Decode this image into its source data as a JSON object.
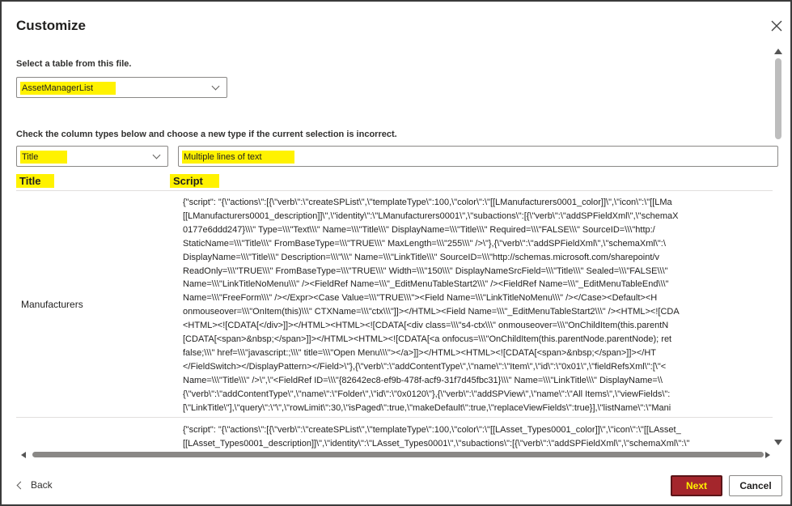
{
  "dialog": {
    "title": "Customize",
    "close_icon": "close-icon"
  },
  "table_section": {
    "label": "Select a table from this file.",
    "selected_table": "AssetManagerList"
  },
  "column_section": {
    "label": "Check the column types below and choose a new type if the current selection is incorrect.",
    "title_column_type": "Title",
    "script_column_type": "Multiple lines of text"
  },
  "grid": {
    "headers": [
      "Title",
      "Script"
    ],
    "rows": [
      {
        "title": "Manufacturers",
        "script_lines": [
          "{\"script\": \"{\\\"actions\\\":[{\\\"verb\\\":\\\"createSPList\\\",\\\"templateType\\\":100,\\\"color\\\":\\\"[[LManufacturers0001_color]]\\\",\\\"icon\\\":\\\"[[LMa",
          "[[LManufacturers0001_description]]\\\",\\\"identity\\\":\\\"LManufacturers0001\\\",\\\"subactions\\\":[{\\\"verb\\\":\\\"addSPFieldXml\\\",\\\"schemaX",
          "0177e6ddd247}\\\\\\\" Type=\\\\\\\"Text\\\\\\\" Name=\\\\\\\"Title\\\\\\\" DisplayName=\\\\\\\"Title\\\\\\\" Required=\\\\\\\"FALSE\\\\\\\" SourceID=\\\\\\\"http:/",
          "StaticName=\\\\\\\"Title\\\\\\\" FromBaseType=\\\\\\\"TRUE\\\\\\\" MaxLength=\\\\\\\"255\\\\\\\" />\\\"},{\\\"verb\\\":\\\"addSPFieldXml\\\",\\\"schemaXml\\\":\\",
          "DisplayName=\\\\\\\"Title\\\\\\\" Description=\\\\\\\"\\\\\\\" Name=\\\\\\\"LinkTitle\\\\\\\" SourceID=\\\\\\\"http://schemas.microsoft.com/sharepoint/v",
          "ReadOnly=\\\\\\\"TRUE\\\\\\\" FromBaseType=\\\\\\\"TRUE\\\\\\\" Width=\\\\\\\"150\\\\\\\" DisplayNameSrcField=\\\\\\\"Title\\\\\\\" Sealed=\\\\\\\"FALSE\\\\\\\"",
          "Name=\\\\\\\"LinkTitleNoMenu\\\\\\\" /><FieldRef Name=\\\\\\\"_EditMenuTableStart2\\\\\\\" /><FieldRef Name=\\\\\\\"_EditMenuTableEnd\\\\\\\"",
          "Name=\\\\\\\"FreeForm\\\\\\\" /></Expr><Case Value=\\\\\\\"TRUE\\\\\\\"><Field Name=\\\\\\\"LinkTitleNoMenu\\\\\\\" /></Case><Default><H",
          "onmouseover=\\\\\\\"OnItem(this)\\\\\\\" CTXName=\\\\\\\"ctx\\\\\\\"]]></HTML><Field Name=\\\\\\\"_EditMenuTableStart2\\\\\\\" /><HTML><![CDA",
          "<HTML><![CDATA[</div>]]></HTML><HTML><![CDATA[<div class=\\\\\\\"s4-ctx\\\\\\\" onmouseover=\\\\\\\"OnChildItem(this.parentN",
          "[CDATA[<span>&nbsp;</span>]]></HTML><HTML><![CDATA[<a onfocus=\\\\\\\"OnChildItem(this.parentNode.parentNode); ret",
          "false;\\\\\\\" href=\\\\\\\"javascript:;\\\\\\\" title=\\\\\\\"Open Menu\\\\\\\"></a>]]></HTML><HTML><![CDATA[<span>&nbsp;</span>]]></HT",
          "</FieldSwitch></DisplayPattern></Field>\\\"},{\\\"verb\\\":\\\"addContentType\\\",\\\"name\\\":\\\"Item\\\",\\\"id\\\":\\\"0x01\\\",\\\"fieldRefsXml\\\":[\\\"<",
          "Name=\\\\\\\"Title\\\\\\\" />\\\",\\\"<FieldRef ID=\\\\\\\"{82642ec8-ef9b-478f-acf9-31f7d45fbc31}\\\\\\\" Name=\\\\\\\"LinkTitle\\\\\\\" DisplayName=\\\\",
          "{\\\"verb\\\":\\\"addContentType\\\",\\\"name\\\":\\\"Folder\\\",\\\"id\\\":\\\"0x0120\\\"},{\\\"verb\\\":\\\"addSPView\\\",\\\"name\\\":\\\"All Items\\\",\\\"viewFields\\\":",
          "[\\\"LinkTitle\\\"],\\\"query\\\":\\\"\\\",\\\"rowLimit\\\":30,\\\"isPaged\\\":true,\\\"makeDefault\\\":true,\\\"replaceViewFields\\\":true}],\\\"listName\\\":\\\"Mani"
        ]
      },
      {
        "title": "",
        "script_lines": [
          "{\"script\": \"{\\\"actions\\\":[{\\\"verb\\\":\\\"createSPList\\\",\\\"templateType\\\":100,\\\"color\\\":\\\"[[LAsset_Types0001_color]]\\\",\\\"icon\\\":\\\"[[LAsset_",
          "[[LAsset_Types0001_description]]\\\",\\\"identity\\\":\\\"LAsset_Types0001\\\",\\\"subactions\\\":[{\\\"verb\\\":\\\"addSPFieldXml\\\",\\\"schemaXml\\\":\\\""
        ]
      }
    ]
  },
  "footer": {
    "back_label": "Back",
    "next_label": "Next",
    "cancel_label": "Cancel"
  },
  "colors": {
    "primary_button": "#a4262c",
    "highlight": "#fff200"
  }
}
